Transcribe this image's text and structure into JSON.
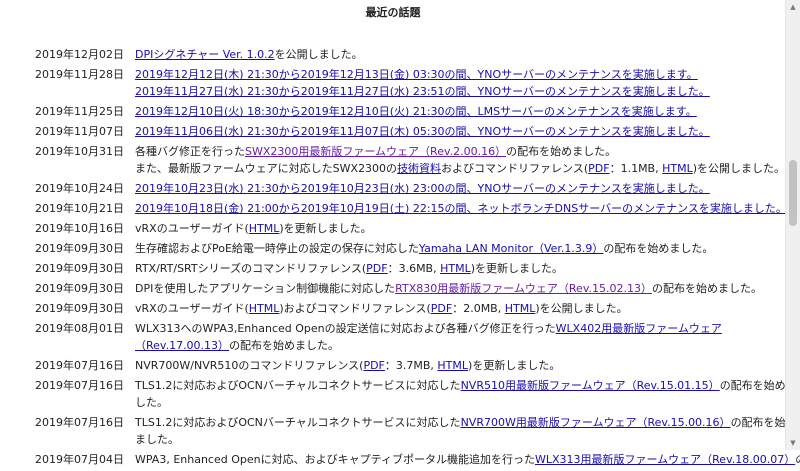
{
  "page": {
    "title": "最近の話題"
  },
  "items": [
    {
      "date": "2019年12月02日",
      "l1": {
        "a1": "DPIシグネチャー Ver. 1.0.2",
        "t2": "を公開しました。"
      }
    },
    {
      "date": "2019年11月28日",
      "l1": {
        "a1": "2019年12月12日(木) 21:30から2019年12月13日(金) 03:30の間、YNOサーバーのメンテナンスを実施します。"
      },
      "l2": {
        "a1": "2019年11月27日(水) 21:30から2019年11月27日(水) 23:51の間、YNOサーバーのメンテナンスを実施しました。"
      }
    },
    {
      "date": "2019年11月25日",
      "l1": {
        "a1": "2019年12月10日(火) 18:30から2019年12月10日(火) 21:30の間、LMSサーバーのメンテナンスを実施します。"
      }
    },
    {
      "date": "2019年11月07日",
      "l1": {
        "a1": "2019年11月06日(水) 21:30から2019年11月07日(木) 05:30の間、YNOサーバーのメンテナンスを実施しました。"
      }
    },
    {
      "date": "2019年10月31日",
      "l1": {
        "t1": "各種バグ修正を行った",
        "a1": "SWX2300用最新版ファームウェア（Rev.2.00.16）",
        "t2": "の配布を始めました。"
      },
      "l2": {
        "t1": "また、最新版ファームウェアに対応したSWX2300の",
        "a1": "技術資料",
        "t2": "およびコマンドリファレンス(",
        "a2": "PDF",
        "t3": "：1.1MB, ",
        "a3": "HTML",
        "t4": ")を公開しました。"
      }
    },
    {
      "date": "2019年10月24日",
      "l1": {
        "a1": "2019年10月23日(水) 21:30から2019年10月23日(水) 23:00の間、YNOサーバーのメンテナンスを実施しました。"
      }
    },
    {
      "date": "2019年10月21日",
      "l1": {
        "a1": "2019年10月18日(金) 21:00から2019年10月19日(土) 22:15の間、ネットボランチDNSサーバーのメンテナンスを実施しました。"
      }
    },
    {
      "date": "2019年10月16日",
      "l1": {
        "t1": "vRXのユーザーガイド(",
        "a1": "HTML",
        "t2": ")を更新しました。"
      }
    },
    {
      "date": "2019年09月30日",
      "l1": {
        "t1": "生存確認およびPoE給電一時停止の設定の保存に対応した",
        "a1": "Yamaha LAN Monitor（Ver.1.3.9）",
        "t2": "の配布を始めました。"
      }
    },
    {
      "date": "2019年09月30日",
      "l1": {
        "t1": "RTX/RT/SRTシリーズのコマンドリファレンス(",
        "a1": "PDF",
        "t2": "：3.6MB, ",
        "a2": "HTML",
        "t3": ")を更新しました。"
      }
    },
    {
      "date": "2019年09月30日",
      "l1": {
        "t1": "DPIを使用したアプリケーション制御機能に対応した",
        "a1": "RTX830用最新版ファームウェア（Rev.15.02.13）",
        "t2": "の配布を始めました。"
      }
    },
    {
      "date": "2019年09月30日",
      "l1": {
        "t1": "vRXのユーザーガイド(",
        "a1": "HTML",
        "t2": ")およびコマンドリファレンス(",
        "a2": "PDF",
        "t3": "：2.0MB, ",
        "a3": "HTML",
        "t4": ")を公開しました。"
      }
    },
    {
      "date": "2019年08月01日",
      "l1": {
        "t1": "WLX313へのWPA3,Enhanced Openの設定送信に対応および各種バグ修正を行った",
        "a1": "WLX402用最新版ファームウェア"
      },
      "l2": {
        "a1": "（Rev.17.00.13）",
        "t2": "の配布を始めました。"
      }
    },
    {
      "date": "2019年07月16日",
      "l1": {
        "t1": "NVR700W/NVR510のコマンドリファレンス(",
        "a1": "PDF",
        "t2": "：3.7MB, ",
        "a2": "HTML",
        "t3": ")を更新しました。"
      }
    },
    {
      "date": "2019年07月16日",
      "l1": {
        "t1": "TLS1.2に対応およびOCNバーチャルコネクトサービスに対応した",
        "a1": "NVR510用最新版ファームウェア（Rev.15.01.15）",
        "t2": "の配布を始めま"
      },
      "l2": {
        "t1": "した。"
      }
    },
    {
      "date": "2019年07月16日",
      "l1": {
        "t1": "TLS1.2に対応およびOCNバーチャルコネクトサービスに対応した",
        "a1": "NVR700W用最新版ファームウェア（Rev.15.00.16）",
        "t2": "の配布を始め"
      },
      "l2": {
        "t1": "ました。"
      }
    },
    {
      "date": "2019年07月04日",
      "l1": {
        "t1": "WPA3, Enhanced Openに対応、およびキャプティブポータル機能追加を行った",
        "a1": "WLX313用最新版ファームウェア（Rev.18.00.07）",
        "t2": "の"
      }
    }
  ]
}
